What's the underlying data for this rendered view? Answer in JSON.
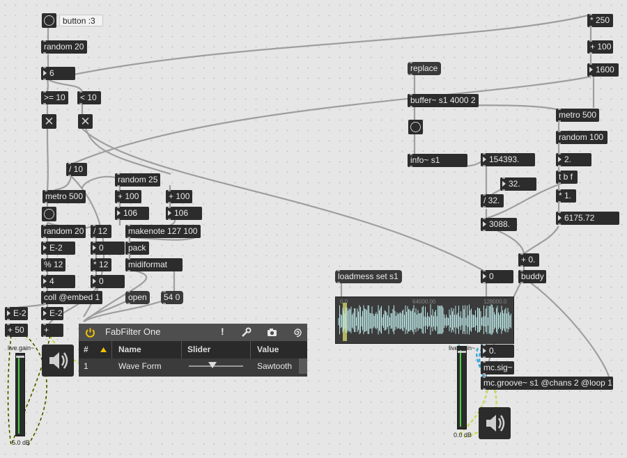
{
  "patcher": {
    "button_comment": "button :3",
    "random20_top": "random 20",
    "num_6": "6",
    "ge10": ">= 10",
    "lt10": "< 10",
    "div10": "/ 10",
    "metro500_left": "metro 500",
    "random25": "random 25",
    "plus100_a": "+ 100",
    "plus100_b": "+ 100",
    "num106_a": "106",
    "num106_b": "106",
    "random20_bottom": "random 20",
    "div12": "/ 12",
    "makenote": "makenote 127 100",
    "note_e2": "E-2",
    "num_0_a": "0",
    "pack": "pack",
    "mod12": "% 12",
    "mul12": "* 12",
    "midiformat": "midiformat",
    "num_4": "4",
    "num_0_b": "0",
    "coll": "coll @embed 1",
    "open": "open",
    "msg540": "54 0",
    "note_e2_a": "E-2",
    "note_e2_b": "E-2",
    "plus50": "+ 50",
    "plus": "+",
    "mul250": "* 250",
    "plus100_c": "+ 100",
    "num1600": "1600",
    "replace": "replace",
    "buffer": "buffer~ s1 4000 2",
    "metro500_right": "metro 500",
    "random100": "random 100",
    "info": "info~ s1",
    "num154393": "154393.",
    "num2": "2.",
    "num32": "32.",
    "tbf": "t b f",
    "div32": "/ 32.",
    "mul1": "* 1.",
    "num3088": "3088.",
    "num6175": "6175.72",
    "plus0": "+ 0.",
    "loadmess": "loadmess set s1",
    "num_0_c": "0",
    "buddy": "buddy",
    "num0dot": "0.",
    "mcsig": "mc.sig~",
    "mcgroove": "mc.groove~ s1 @chans 2 @loop 1"
  },
  "waveform": {
    "markers": [
      "0.0",
      "64000.00",
      "128000.0"
    ]
  },
  "fabfilter": {
    "title": "FabFilter One",
    "headers": {
      "index": "#",
      "name": "Name",
      "slider": "Slider",
      "value": "Value"
    },
    "row": {
      "index": "1",
      "name": "Wave Form",
      "value": "Sawtooth"
    }
  },
  "gain_left": {
    "label": "live.gain~",
    "value": "5.0 dB"
  },
  "gain_right": {
    "label": "live.gain~",
    "value": "0.0 dB"
  },
  "colors": {
    "object_bg": "#2c2c2c",
    "object_text": "#ececec",
    "canvas": "#e6e6e6",
    "cord": "#9e9e9e",
    "signal_cord": "#c8d84a",
    "mc_cord": "#38a8d8",
    "wave": "#bfe9ea"
  },
  "icons": [
    "power-icon",
    "exclamation-icon",
    "wrench-icon",
    "camera-icon",
    "spiral-icon",
    "speaker-icon",
    "sort-arrow-icon"
  ]
}
